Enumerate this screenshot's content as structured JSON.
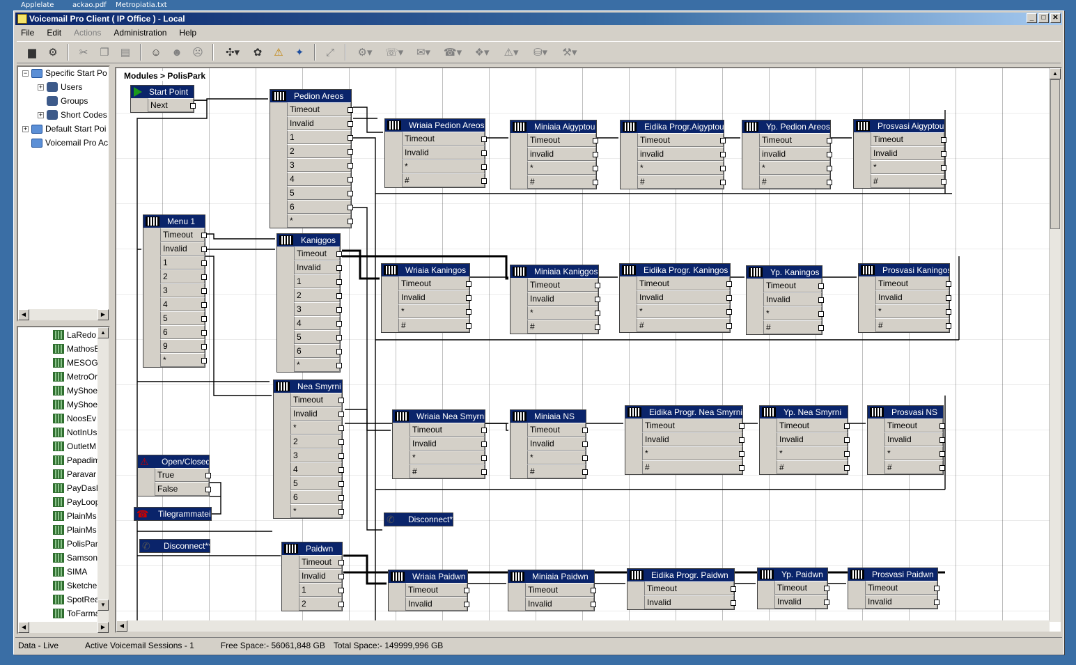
{
  "desktop": {
    "labels": [
      "Applelate",
      "ackao.pdf",
      "Metropiatia.txt"
    ]
  },
  "window": {
    "title": "Voicemail Pro Client   ( IP Office ) -   Local",
    "buttons": [
      "_",
      "□",
      "✕"
    ]
  },
  "menu": {
    "items": [
      "File",
      "Edit",
      "Actions",
      "Administration",
      "Help"
    ]
  },
  "toolbar": {
    "icons": [
      "save-icon",
      "save-all-icon",
      "cut-icon",
      "copy-icon",
      "paste-icon",
      "add-user-icon",
      "add-group-icon",
      "remove-user-icon",
      "action-icon",
      "module-icon",
      "warning-icon",
      "settings-icon",
      "connect-icon",
      "network-icon",
      "telephony-icon",
      "mailbox-icon",
      "phone-icon",
      "queue-icon",
      "condition-icon",
      "database-icon",
      "misc-icon"
    ]
  },
  "tree_top": {
    "items": [
      {
        "label": "Specific Start Po",
        "expander": "−",
        "indent": 0,
        "icon": "folder"
      },
      {
        "label": "Users",
        "expander": "+",
        "indent": 1,
        "icon": "users"
      },
      {
        "label": "Groups",
        "expander": "",
        "indent": 1,
        "icon": "users"
      },
      {
        "label": "Short Codes",
        "expander": "+",
        "indent": 1,
        "icon": "users"
      },
      {
        "label": "Default Start Poi",
        "expander": "+",
        "indent": 0,
        "icon": "folder"
      },
      {
        "label": "Voicemail Pro Ac",
        "expander": "",
        "indent": 0,
        "icon": "folder"
      }
    ]
  },
  "tree_bottom": {
    "items": [
      "LaRedo",
      "MathosE",
      "MESOG",
      "MetroOr",
      "MyShoe",
      "MyShoe",
      "NoosEv",
      "NotInUs",
      "OutletM",
      "Papadim",
      "Paravar",
      "PayDasl",
      "PayLoop",
      "PlainMs",
      "PlainMs",
      "PolisPar",
      "Samson",
      "SIMA",
      "Sketche",
      "SpotRea",
      "ToFarma"
    ]
  },
  "canvas": {
    "breadcrumb": "Modules > PolisPark"
  },
  "nodes": {
    "start": {
      "title": "Start Point",
      "rows": [
        "Next"
      ]
    },
    "pedion": {
      "title": "Pedion Areos",
      "rows": [
        "Timeout",
        "Invalid",
        "1",
        "2",
        "3",
        "4",
        "5",
        "6",
        "*"
      ]
    },
    "menu1": {
      "title": "Menu 1",
      "rows": [
        "Timeout",
        "Invalid",
        "1",
        "2",
        "3",
        "4",
        "5",
        "6",
        "9",
        "*"
      ]
    },
    "kaniggos": {
      "title": "Kaniggos",
      "rows": [
        "Timeout",
        "Invalid",
        "1",
        "2",
        "3",
        "4",
        "5",
        "6",
        "*"
      ]
    },
    "nea": {
      "title": "Nea Smyrni",
      "rows": [
        "Timeout",
        "Invalid",
        "*",
        "2",
        "3",
        "4",
        "5",
        "6",
        "*"
      ]
    },
    "open": {
      "title": "Open/Closed",
      "rows": [
        "True",
        "False"
      ]
    },
    "tilegr": {
      "title": "Tilegrammateia",
      "rows": []
    },
    "disc1": {
      "title": "Disconnect*",
      "rows": []
    },
    "disc2": {
      "title": "Disconnect**",
      "rows": []
    },
    "paidwn": {
      "title": "Paidwn",
      "rows": [
        "Timeout",
        "Invalid",
        "1",
        "2"
      ]
    },
    "r1c1": {
      "title": "Wriaia Pedion Areos",
      "rows": [
        "Timeout",
        "Invalid",
        "*",
        "#"
      ]
    },
    "r1c2": {
      "title": "Miniaia Aigyptou",
      "rows": [
        "Timeout",
        "invalid",
        "*",
        "#"
      ]
    },
    "r1c3": {
      "title": "Eidika Progr.Aigyptou",
      "rows": [
        "Timeout",
        "invalid",
        "*",
        "#"
      ]
    },
    "r1c4": {
      "title": "Yp. Pedion Areos",
      "rows": [
        "Timeout",
        "invalid",
        "*",
        "#"
      ]
    },
    "r1c5": {
      "title": "Prosvasi Aigyptou",
      "rows": [
        "Timeout",
        "Invalid",
        "*",
        "#"
      ]
    },
    "r2c1": {
      "title": "Wriaia Kaningos",
      "rows": [
        "Timeout",
        "Invalid",
        "*",
        "#"
      ]
    },
    "r2c2": {
      "title": "Miniaia Kaniggos",
      "rows": [
        "Timeout",
        "Invalid",
        "*",
        "#"
      ]
    },
    "r2c3": {
      "title": "Eidika Progr. Kaningos",
      "rows": [
        "Timeout",
        "Invalid",
        "*",
        "#"
      ]
    },
    "r2c4": {
      "title": "Yp. Kaningos",
      "rows": [
        "Timeout",
        "Invalid",
        "*",
        "#"
      ]
    },
    "r2c5": {
      "title": "Prosvasi Kaningos",
      "rows": [
        "Timeout",
        "Invalid",
        "*",
        "#"
      ]
    },
    "r3c1": {
      "title": "Wriaia Nea Smyrni",
      "rows": [
        "Timeout",
        "Invalid",
        "*",
        "#"
      ]
    },
    "r3c2": {
      "title": "Miniaia   NS",
      "rows": [
        "Timeout",
        "Invalid",
        "*",
        "#"
      ]
    },
    "r3c3": {
      "title": "Eidika Progr. Nea Smyrni",
      "rows": [
        "Timeout",
        "Invalid",
        "*",
        "#"
      ]
    },
    "r3c4": {
      "title": "Yp. Nea Smyrni",
      "rows": [
        "Timeout",
        "Invalid",
        "*",
        "#"
      ]
    },
    "r3c5": {
      "title": "Prosvasi NS",
      "rows": [
        "Timeout",
        "Invalid",
        "*",
        "#"
      ]
    },
    "r4c1": {
      "title": "Wriaia Paidwn",
      "rows": [
        "Timeout",
        "Invalid"
      ]
    },
    "r4c2": {
      "title": "Miniaia Paidwn",
      "rows": [
        "Timeout",
        "Invalid"
      ]
    },
    "r4c3": {
      "title": "Eidika Progr. Paidwn",
      "rows": [
        "Timeout",
        "Invalid"
      ]
    },
    "r4c4": {
      "title": "Yp. Paidwn",
      "rows": [
        "Timeout",
        "Invalid"
      ]
    },
    "r4c5": {
      "title": "Prosvasi Paidwn",
      "rows": [
        "Timeout",
        "Invalid"
      ]
    }
  },
  "status": {
    "mode": "Data - Live",
    "sessions": "Active Voicemail Sessions - 1",
    "free": "Free Space:- 56061,848 GB",
    "total": "Total Space:- 149999,996 GB"
  }
}
